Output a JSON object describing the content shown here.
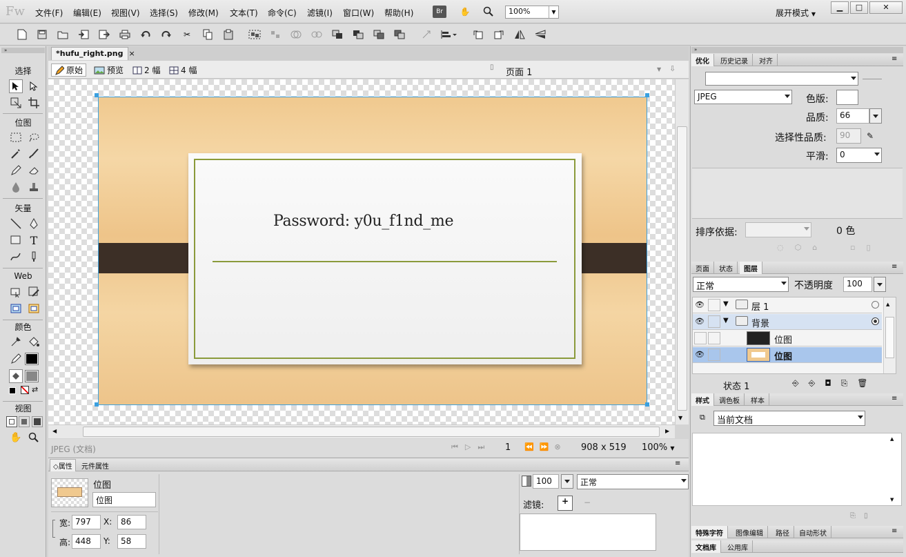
{
  "app": {
    "logo": "Fw",
    "menus": [
      "文件(F)",
      "编辑(E)",
      "视图(V)",
      "选择(S)",
      "修改(M)",
      "文本(T)",
      "命令(C)",
      "滤镜(I)",
      "窗口(W)",
      "帮助(H)"
    ],
    "br": "Br",
    "zoom": "100%",
    "workspace": "展开模式"
  },
  "tools": {
    "select": "选择",
    "bitmap": "位图",
    "vector": "矢量",
    "web": "Web",
    "colors": "颜色",
    "view": "视图"
  },
  "document": {
    "tab": "*hufu_right.png",
    "views": [
      "原始",
      "预览",
      "2 幅",
      "4 幅"
    ],
    "page": "页面 1",
    "password_text": "Password: y0u_f1nd_me",
    "status_left": "JPEG (文档)",
    "frame": "1",
    "size": "908 x 519",
    "zoom": "100%"
  },
  "properties": {
    "tabs": [
      "属性",
      "元件属性"
    ],
    "type": "位图",
    "name": "位图",
    "w_label": "宽:",
    "w": "797",
    "h_label": "高:",
    "h": "448",
    "x_label": "X:",
    "x": "86",
    "y_label": "Y:",
    "y": "58",
    "opacity": "100",
    "blend": "正常",
    "filters_label": "滤镜:"
  },
  "optimize": {
    "tabs": [
      "优化",
      "历史记录",
      "对齐"
    ],
    "format": "JPEG",
    "matte_label": "色版:",
    "quality_label": "品质:",
    "quality": "66",
    "sel_quality_label": "选择性品质:",
    "sel_quality": "90",
    "smooth_label": "平滑:",
    "smooth": "0",
    "sort_label": "排序依据:",
    "colors_count": "0 色"
  },
  "layers": {
    "tabs": [
      "页面",
      "状态",
      "图层"
    ],
    "blend": "正常",
    "opacity_label": "不透明度",
    "opacity": "100",
    "rows": [
      {
        "name": "层 1"
      },
      {
        "name": "背景"
      },
      {
        "name": "位图"
      },
      {
        "name": "位图"
      }
    ],
    "state": "状态  1"
  },
  "styles": {
    "tabs": [
      "样式",
      "调色板",
      "样本"
    ],
    "current": "当前文档"
  },
  "bottom_tabs": {
    "row1": [
      "特殊字符",
      "图像编辑",
      "路径",
      "自动形状"
    ],
    "row2": [
      "文档库",
      "公用库"
    ]
  }
}
